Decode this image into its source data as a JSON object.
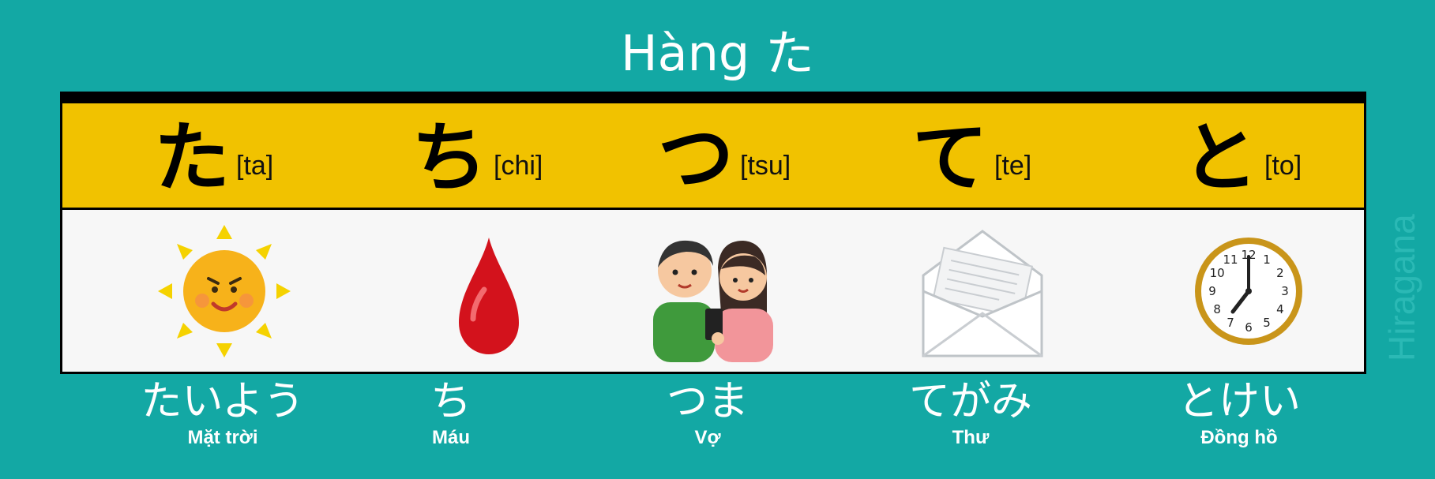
{
  "title": "Hàng た",
  "side_label": "Hiragana",
  "kana": [
    {
      "char": "た",
      "romaji": "[ta]",
      "word": "たいよう",
      "meaning": "Mặt trời",
      "icon": "sun-icon"
    },
    {
      "char": "ち",
      "romaji": "[chi]",
      "word": "ち",
      "meaning": "Máu",
      "icon": "blood-drop-icon"
    },
    {
      "char": "つ",
      "romaji": "[tsu]",
      "word": "つま",
      "meaning": "Vợ",
      "icon": "couple-icon"
    },
    {
      "char": "て",
      "romaji": "[te]",
      "word": "てがみ",
      "meaning": "Thư",
      "icon": "letter-envelope-icon"
    },
    {
      "char": "と",
      "romaji": "[to]",
      "word": "とけい",
      "meaning": "Đồng hồ",
      "icon": "clock-icon"
    }
  ],
  "clock": {
    "numerals": [
      "12",
      "1",
      "2",
      "3",
      "4",
      "5",
      "6",
      "7",
      "8",
      "9",
      "10",
      "11"
    ]
  },
  "colors": {
    "background": "#13a8a4",
    "header": "#f1c200",
    "panel": "#f7f7f7"
  }
}
